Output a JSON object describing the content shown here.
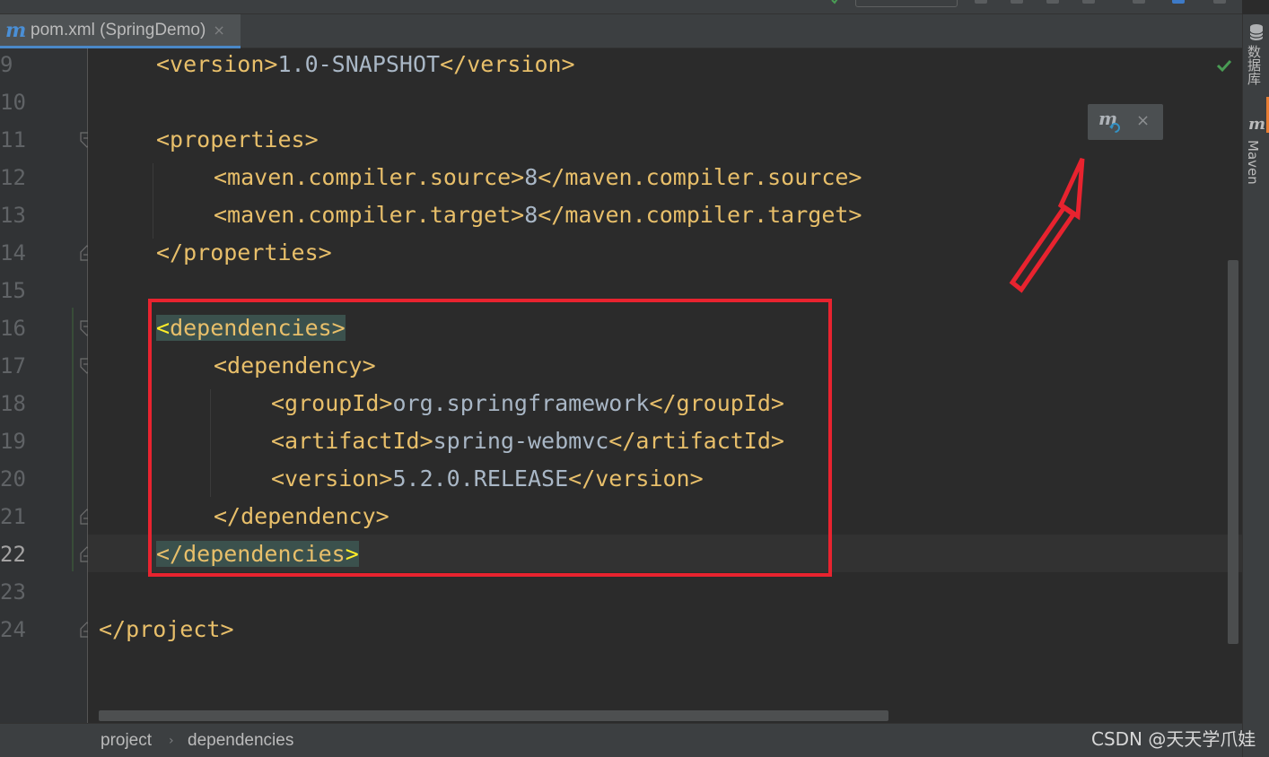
{
  "tab": {
    "icon": "maven-m-icon",
    "title": "pom.xml (SpringDemo)",
    "close": "×",
    "accent": "#4a88c7"
  },
  "line_numbers": [
    "9",
    "10",
    "11",
    "12",
    "13",
    "14",
    "15",
    "16",
    "17",
    "18",
    "19",
    "20",
    "21",
    "22",
    "23",
    "24"
  ],
  "current_line": "22",
  "code": {
    "l9": {
      "open": "<version>",
      "text": "1.0-SNAPSHOT",
      "close": "</version>"
    },
    "l11": "<properties>",
    "l12": {
      "open": "<maven.compiler.source>",
      "text": "8",
      "close": "</maven.compiler.source>"
    },
    "l13": {
      "open": "<maven.compiler.target>",
      "text": "8",
      "close": "</maven.compiler.target>"
    },
    "l14": "</properties>",
    "l16": {
      "bracket": "<",
      "rest": "dependencies>"
    },
    "l17": "<dependency>",
    "l18": {
      "open": "<groupId>",
      "text": "org.springframework",
      "close": "</groupId>"
    },
    "l19": {
      "open": "<artifactId>",
      "text": "spring-webmvc",
      "close": "</artifactId>"
    },
    "l20": {
      "open": "<version>",
      "text": "5.2.0.RELEASE",
      "close": "</version>"
    },
    "l21": "</dependency>",
    "l22": {
      "rest": "</dependencies",
      "bracket": ">"
    },
    "l24": "</project>"
  },
  "maven_popup": {
    "icon": "maven-reload-icon",
    "close": "×"
  },
  "right_strip": {
    "database_label": "数据库",
    "maven_label": "Maven",
    "maven_icon": "m"
  },
  "breadcrumb": [
    "project",
    "dependencies"
  ],
  "breadcrumb_sep": "›",
  "watermark": "CSDN @天天学爪娃",
  "annotation_color": "#e8232f"
}
